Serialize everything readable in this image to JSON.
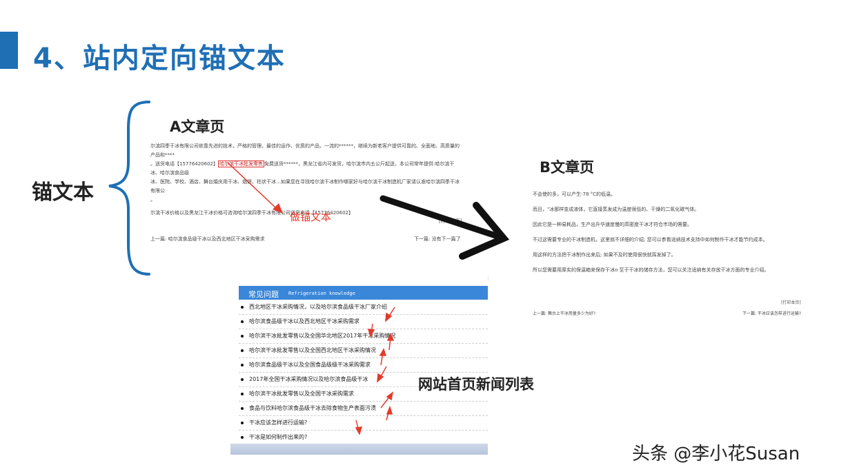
{
  "title": "4、站内定向锚文本",
  "left_label": "锚文本",
  "article_a": {
    "heading": "A文章页",
    "line1": "尔滨四季干冰有限公司依靠先进的技术，严格的管理，最佳的运作、优质的产品，一流的******，继续为新老客户提供可靠的、全面地、高质量的产品和****",
    "line2_before": "。送货电话【15776420602】",
    "anchor_text": "哈尔滨干冰批发零售",
    "line2_after": "免费送货******，黑龙江省内可发货，哈尔滨市内五公斤起送，本公司常年提供:哈尔滨干冰、哈尔滨食品级",
    "line3": "冰、医院、学校、酒店、舞台婚庆用干冰、烟饼、柱状干冰…如果您在寻找哈尔滨干冰制作哪家好与哈尔滨干冰制造机厂家请认准哈尔滨四季干冰有限公",
    "line4": "。",
    "line5": "尔滨干冰价格以及黑龙江干冰价格可咨询哈尔滨四季干冰有限公司送货电话【15776420602】",
    "note": "做锚文本",
    "print": "[打印本页]",
    "prev": "上一篇: 哈尔滨食品级干冰以及西北地区干冰采购需求",
    "next": "下一篇: 没有下一篇了"
  },
  "article_b": {
    "heading": "B文章页",
    "paragraphs": [
      "不会使的多，可以产生-78 °C的低温。",
      "而且，\"冰那样变成液体，它直接蒸发成为温度很低的、干燥的二氧化碳气体。",
      "因此它是一种易耗品，生产出升华速度慢的高密度干冰才符合市场的需要。",
      "不过这需要专业的干冰制造机，这里就不详细的介绍; 您可以参看适纳技术支持中如何制作干冰才能节约成本。",
      "用这样的方法把干冰制作出来后; 如果不及时使用很快就挥发掉了。",
      "所以您需要用厚实的保温箱来保存干冰o 至于干冰的储存方法，您可以关注适纳有关存放干冰方面的专业介绍。"
    ],
    "print": "[打印本页]",
    "prev": "上一篇: 舞台上干冰用量多少为好?",
    "next": "下一篇: 干冰应该怎样进行运输?"
  },
  "news": {
    "header_cn": "常见问题",
    "header_en": "Refrigeration knowledge",
    "label": "网站首页新闻列表",
    "items": [
      "西北地区干冰采购情况，以及哈尔滨食品级干冰厂家介绍",
      "哈尔滨食品级干冰以及西北地区干冰采购需求",
      "哈尔滨干冰批发零售以及全国华北地区2017年干冰采购情况",
      "哈尔滨干冰批发零售以及全国西北地区干冰采购情况",
      "哈尔滨食品级干冰以及全国食品级级干冰采购需求",
      "2017年全国干冰采购情况以及哈尔滨食品级干冰",
      "哈尔滨干冰批发零售以及全国干冰采购需求",
      "食品与饮料哈尔滨食品级干冰去除食物生产表面污渍",
      "干冰应该怎样进行运输?",
      "干冰是如何制作出来的?"
    ]
  },
  "watermark": "头条 @李小花Susan",
  "colors": {
    "title": "#1f6fb5",
    "accent_red": "#e23b2b",
    "news_header": "#3a86d9"
  }
}
